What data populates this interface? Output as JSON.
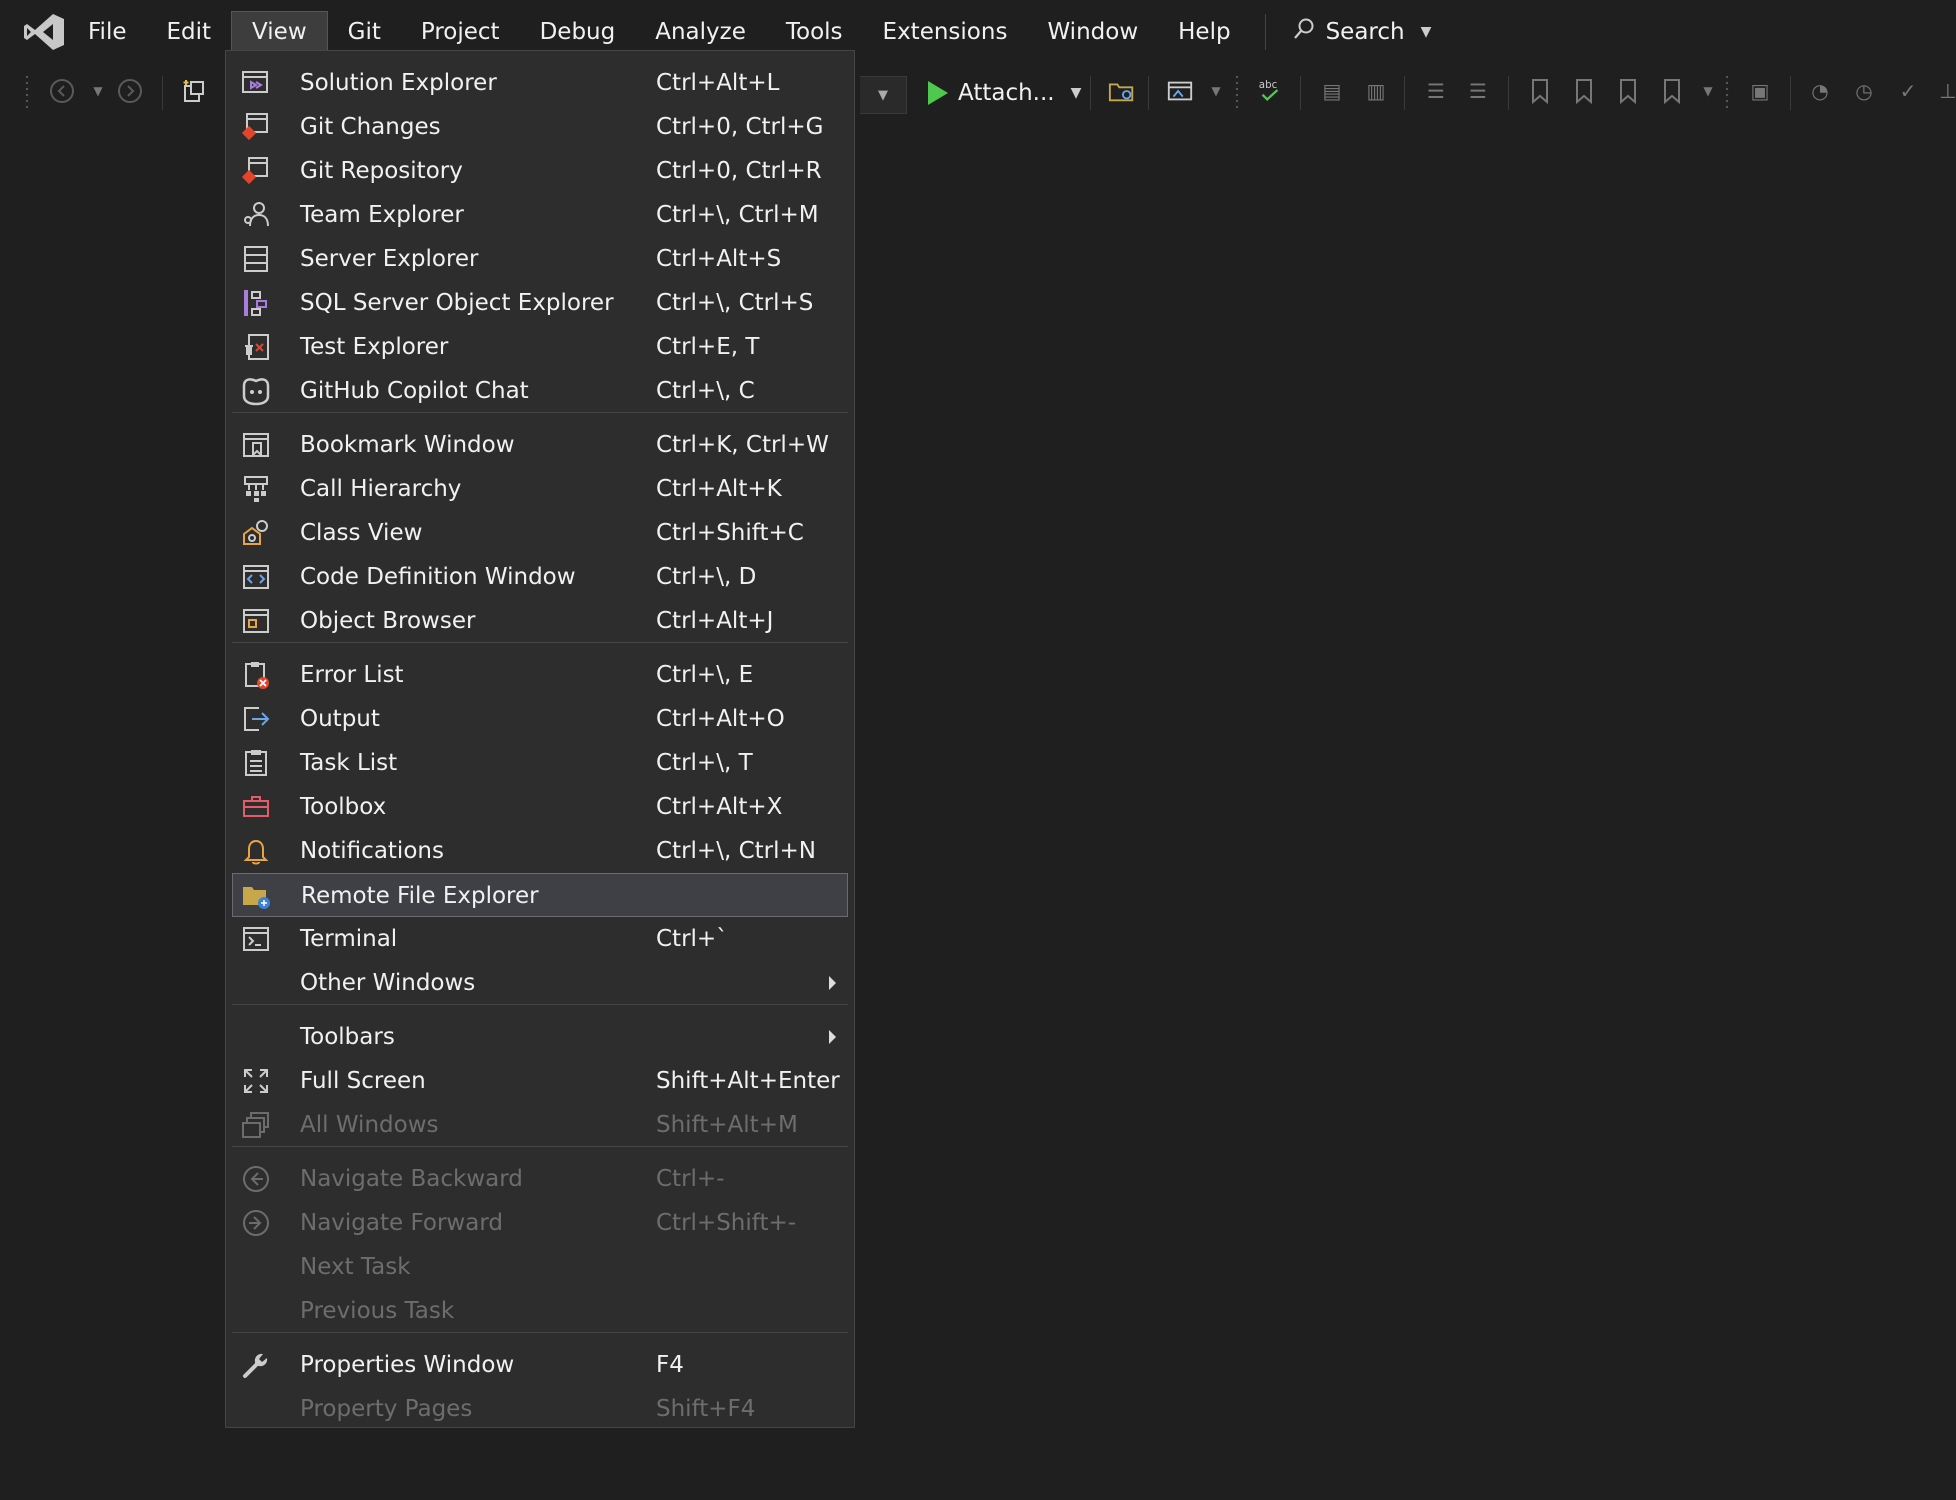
{
  "app": {
    "logo": "visual-studio-logo-icon"
  },
  "menubar": [
    {
      "label": "File"
    },
    {
      "label": "Edit"
    },
    {
      "label": "View"
    },
    {
      "label": "Git"
    },
    {
      "label": "Project"
    },
    {
      "label": "Debug"
    },
    {
      "label": "Analyze"
    },
    {
      "label": "Tools"
    },
    {
      "label": "Extensions"
    },
    {
      "label": "Window"
    },
    {
      "label": "Help"
    }
  ],
  "search": {
    "label": "Search",
    "icon": "search-icon"
  },
  "toolbar": {
    "attach_label": "Attach..."
  },
  "view_menu": {
    "items": [
      {
        "label": "Solution Explorer",
        "shortcut": "Ctrl+Alt+L",
        "icon": "solution-explorer-icon"
      },
      {
        "label": "Git Changes",
        "shortcut": "Ctrl+0, Ctrl+G",
        "icon": "git-changes-icon"
      },
      {
        "label": "Git Repository",
        "shortcut": "Ctrl+0, Ctrl+R",
        "icon": "git-repository-icon"
      },
      {
        "label": "Team Explorer",
        "shortcut": "Ctrl+\\, Ctrl+M",
        "icon": "team-explorer-icon"
      },
      {
        "label": "Server Explorer",
        "shortcut": "Ctrl+Alt+S",
        "icon": "server-explorer-icon"
      },
      {
        "label": "SQL Server Object Explorer",
        "shortcut": "Ctrl+\\, Ctrl+S",
        "icon": "sql-server-icon"
      },
      {
        "label": "Test Explorer",
        "shortcut": "Ctrl+E, T",
        "icon": "test-explorer-icon"
      },
      {
        "label": "GitHub Copilot Chat",
        "shortcut": "Ctrl+\\, C",
        "icon": "copilot-icon"
      },
      {
        "label": "Bookmark Window",
        "shortcut": "Ctrl+K, Ctrl+W",
        "icon": "bookmark-window-icon"
      },
      {
        "label": "Call Hierarchy",
        "shortcut": "Ctrl+Alt+K",
        "icon": "call-hierarchy-icon"
      },
      {
        "label": "Class View",
        "shortcut": "Ctrl+Shift+C",
        "icon": "class-view-icon"
      },
      {
        "label": "Code Definition Window",
        "shortcut": "Ctrl+\\, D",
        "icon": "code-definition-icon"
      },
      {
        "label": "Object Browser",
        "shortcut": "Ctrl+Alt+J",
        "icon": "object-browser-icon"
      },
      {
        "label": "Error List",
        "shortcut": "Ctrl+\\, E",
        "icon": "error-list-icon"
      },
      {
        "label": "Output",
        "shortcut": "Ctrl+Alt+O",
        "icon": "output-icon"
      },
      {
        "label": "Task List",
        "shortcut": "Ctrl+\\, T",
        "icon": "task-list-icon"
      },
      {
        "label": "Toolbox",
        "shortcut": "Ctrl+Alt+X",
        "icon": "toolbox-icon"
      },
      {
        "label": "Notifications",
        "shortcut": "Ctrl+\\, Ctrl+N",
        "icon": "bell-icon"
      },
      {
        "label": "Remote File Explorer",
        "shortcut": "",
        "icon": "remote-file-explorer-icon"
      },
      {
        "label": "Terminal",
        "shortcut": "Ctrl+`",
        "icon": "terminal-icon"
      },
      {
        "label": "Other Windows",
        "shortcut": "",
        "icon": ""
      },
      {
        "label": "Toolbars",
        "shortcut": "",
        "icon": ""
      },
      {
        "label": "Full Screen",
        "shortcut": "Shift+Alt+Enter",
        "icon": "full-screen-icon"
      },
      {
        "label": "All Windows",
        "shortcut": "Shift+Alt+M",
        "icon": "all-windows-icon"
      },
      {
        "label": "Navigate Backward",
        "shortcut": "Ctrl+-",
        "icon": "navigate-backward-icon"
      },
      {
        "label": "Navigate Forward",
        "shortcut": "Ctrl+Shift+-",
        "icon": "navigate-forward-icon"
      },
      {
        "label": "Next Task",
        "shortcut": "",
        "icon": ""
      },
      {
        "label": "Previous Task",
        "shortcut": "",
        "icon": ""
      },
      {
        "label": "Properties Window",
        "shortcut": "F4",
        "icon": "wrench-icon"
      },
      {
        "label": "Property Pages",
        "shortcut": "Shift+F4",
        "icon": ""
      }
    ],
    "highlighted_item": "Remote File Explorer",
    "disabled_items": [
      "All Windows",
      "Navigate Backward",
      "Navigate Forward",
      "Next Task",
      "Previous Task",
      "Property Pages"
    ]
  },
  "colors": {
    "background": "#1f1f1f",
    "menu_background": "#2d2d2d",
    "highlight": "#3f3f46",
    "disabled_text": "#6d6d6d",
    "play_green": "#4ec94e"
  }
}
